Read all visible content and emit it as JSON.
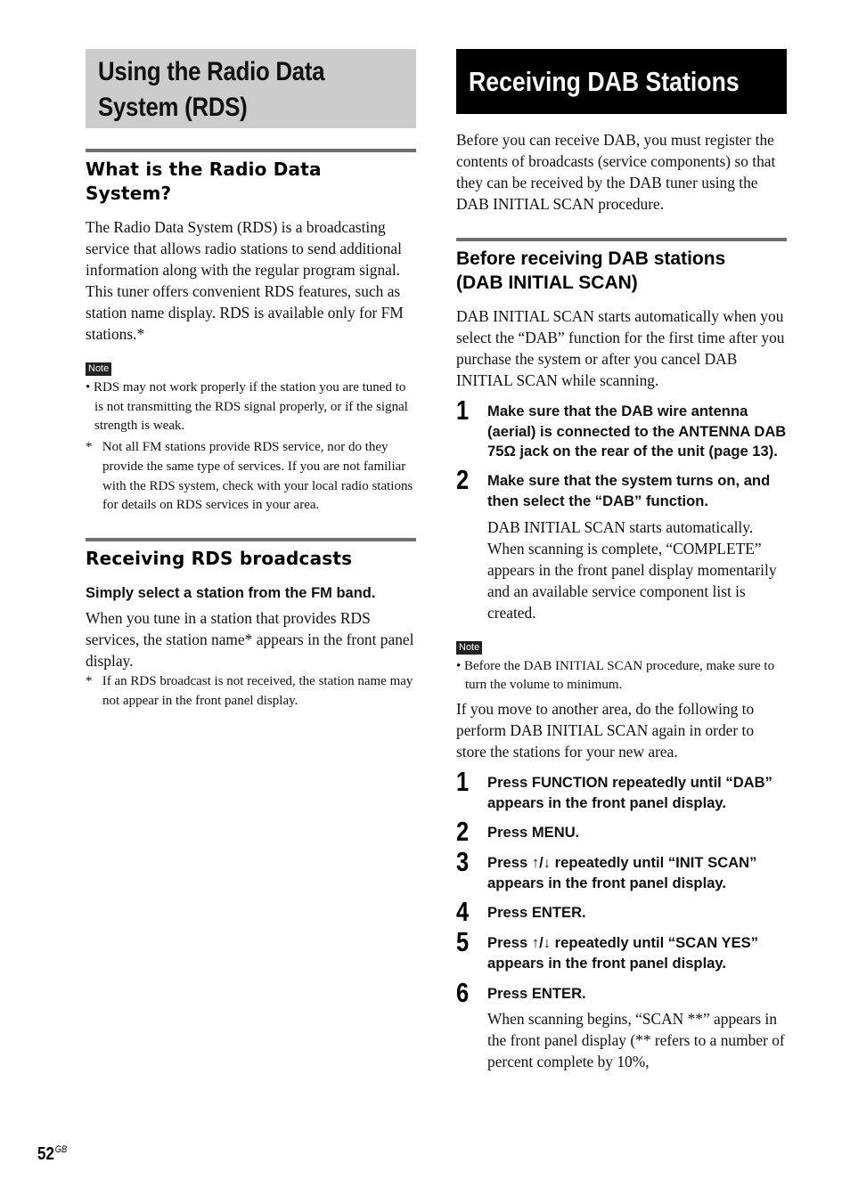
{
  "left": {
    "section_title": [
      "Using the Radio Data",
      "System (RDS)"
    ],
    "what_is": {
      "heading": [
        "What is the Radio Data",
        "System?"
      ],
      "body": "The Radio Data System (RDS) is a broadcasting service that allows radio stations to send additional information along with the regular program signal. This tuner offers convenient RDS features, such as station name display. RDS is available only for FM stations.*",
      "note_label": "Note",
      "note_bullet": "• RDS may not work properly if the station you are tuned to is not transmitting the RDS signal properly, or if the signal strength is weak.",
      "footnote": "*   Not all FM stations provide RDS service, nor do they provide the same type of services. If you are not familiar with the RDS system, check with your local radio stations for details on RDS services in your area."
    },
    "receiving_rds": {
      "heading": "Receiving RDS broadcasts",
      "subhead": "Simply select a station from the FM band.",
      "body": "When you tune in a station that provides RDS services, the station name* appears in the front panel display.",
      "footnote": "*   If an RDS broadcast is not received, the station name may not appear in the front panel display."
    }
  },
  "right": {
    "section_title": "Receiving DAB Stations",
    "intro": "Before you can receive DAB, you must register the contents of broadcasts (service components) so that they can be received by the DAB tuner using the DAB INITIAL SCAN procedure.",
    "before": {
      "heading": [
        "Before receiving DAB stations",
        "(DAB INITIAL SCAN)"
      ],
      "body": "DAB INITIAL SCAN starts automatically when you select the “DAB” function for the first time after you purchase the system or after you cancel DAB INITIAL SCAN while scanning.",
      "steps": [
        {
          "num": "1",
          "text": "Make sure that the DAB wire antenna (aerial) is connected to the ANTENNA DAB 75Ω jack on the rear of the unit (page 13).",
          "desc": ""
        },
        {
          "num": "2",
          "text": "Make sure that the system turns on, and then select the “DAB” function.",
          "desc": "DAB INITIAL SCAN starts automatically. When scanning is complete, “COMPLETE” appears in the front panel display momentarily and an available service component list is created."
        }
      ],
      "note_label": "Note",
      "note_bullet": "• Before the DAB INITIAL SCAN procedure, make sure to turn the volume to minimum.",
      "move_text": "If you move to another area, do the following to perform DAB INITIAL SCAN again in order to store the stations for your new area.",
      "steps2": [
        {
          "num": "1",
          "text": "Press FUNCTION repeatedly until “DAB” appears in the front panel display.",
          "desc": ""
        },
        {
          "num": "2",
          "text": "Press MENU.",
          "desc": ""
        },
        {
          "num": "3",
          "text": "Press ↑/↓ repeatedly until “INIT SCAN” appears in the front panel display.",
          "desc": ""
        },
        {
          "num": "4",
          "text": "Press ENTER.",
          "desc": ""
        },
        {
          "num": "5",
          "text": "Press ↑/↓ repeatedly until “SCAN YES” appears in the front panel display.",
          "desc": ""
        },
        {
          "num": "6",
          "text": "Press ENTER.",
          "desc": "When scanning begins, “SCAN **” appears in the front panel display (** refers to a number of percent complete by 10%,"
        }
      ]
    }
  },
  "footer": {
    "page_number": "52",
    "page_suffix": "GB"
  }
}
